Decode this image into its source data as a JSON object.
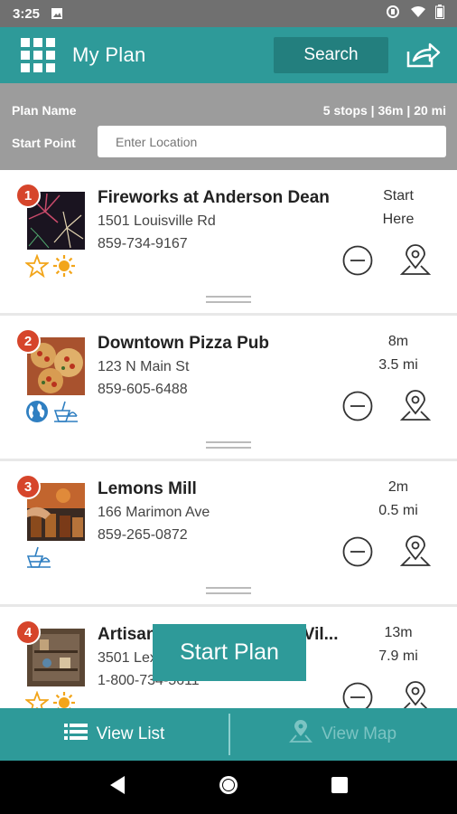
{
  "status_bar": {
    "time": "3:25"
  },
  "app_bar": {
    "title": "My Plan",
    "search_label": "Search"
  },
  "plan": {
    "name_label": "Plan Name",
    "stats": "5 stops | 36m | 20 mi",
    "start_label": "Start Point",
    "location_placeholder": "Enter Location"
  },
  "stops": [
    {
      "number": "1",
      "name": "Fireworks at Anderson Dean",
      "address": "1501 Louisville Rd",
      "phone": "859-734-9167",
      "time": "Start",
      "distance": "Here",
      "tags": [
        "star-icon",
        "sun-icon"
      ]
    },
    {
      "number": "2",
      "name": "Downtown Pizza Pub",
      "address": "123 N Main St",
      "phone": "859-605-6488",
      "time": "8m",
      "distance": "3.5 mi",
      "tags": [
        "globe-icon",
        "food-icon"
      ]
    },
    {
      "number": "3",
      "name": "Lemons Mill",
      "address": "166 Marimon Ave",
      "phone": "859-265-0872",
      "time": "2m",
      "distance": "0.5 mi",
      "tags": [
        "food-icon"
      ]
    },
    {
      "number": "4",
      "name": "Artisan Village at Shaker Vil...",
      "address": "3501 Lexington Rd",
      "phone": "1-800-734-5611",
      "time": "13m",
      "distance": "7.9 mi",
      "tags": [
        "star-icon",
        "sun-icon"
      ]
    }
  ],
  "start_plan_label": "Start Plan",
  "bottom_tabs": {
    "list_label": "View List",
    "map_label": "View Map"
  },
  "colors": {
    "primary": "#2e9a99",
    "primary_dark": "#237f7e",
    "badge": "#d6452b",
    "plan_bar": "#9c9c9c",
    "star": "#f2a51a",
    "blue_icon": "#2f7fc1"
  }
}
